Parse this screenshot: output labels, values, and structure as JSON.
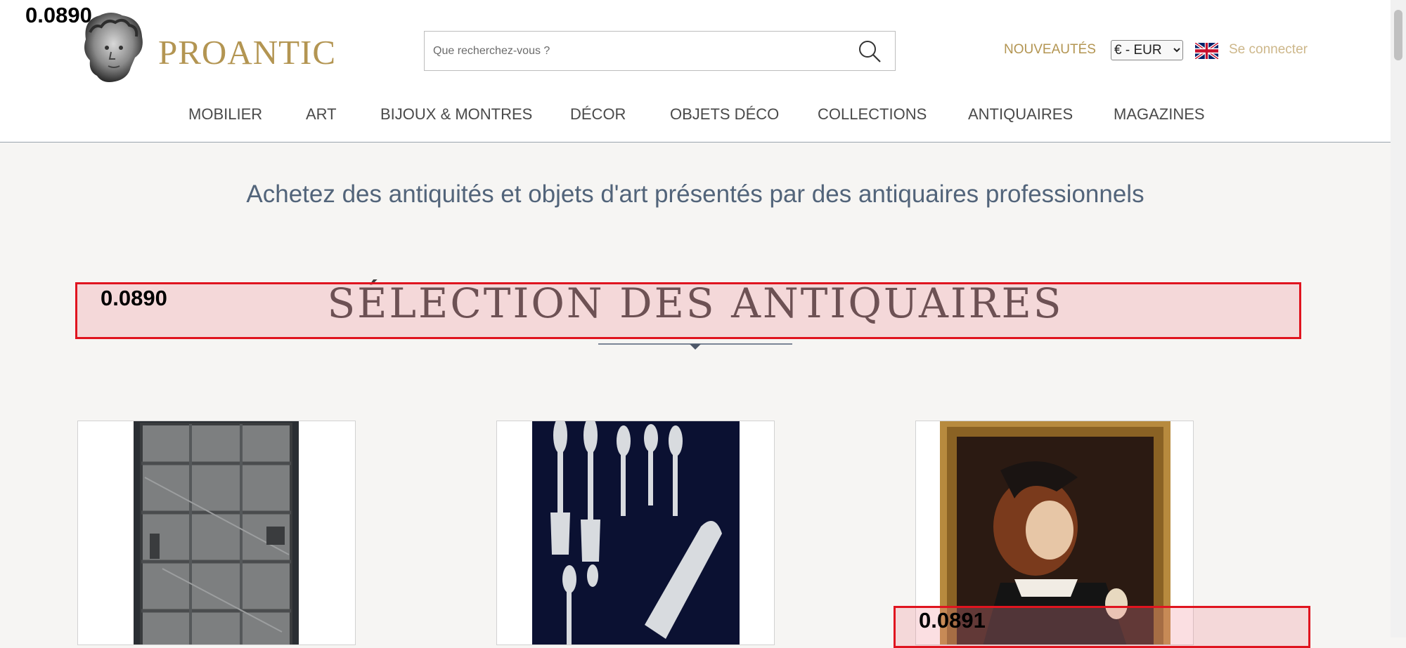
{
  "logo": {
    "text": "PROANTIC",
    "icon": "marble-bust-icon"
  },
  "search": {
    "placeholder": "Que recherchez-vous ?",
    "icon": "search-icon"
  },
  "header": {
    "nouveautes": "NOUVEAUTÉS",
    "currency": "€ - EUR",
    "language_icon": "uk-flag-icon",
    "login": "Se connecter"
  },
  "nav": {
    "items": [
      {
        "label": "MOBILIER"
      },
      {
        "label": "ART"
      },
      {
        "label": "BIJOUX & MONTRES"
      },
      {
        "label": "DÉCOR"
      },
      {
        "label": "OBJETS DÉCO"
      },
      {
        "label": "COLLECTIONS"
      },
      {
        "label": "ANTIQUAIRES"
      },
      {
        "label": "MAGAZINES"
      }
    ]
  },
  "tagline": "Achetez des antiquités et objets d'art présentés par des antiquaires professionnels",
  "section": {
    "title": "SÉLECTION DES ANTIQUAIRES"
  },
  "products": [
    {
      "image": "iron-studded-door"
    },
    {
      "image": "silver-cutlery-set"
    },
    {
      "image": "framed-portrait-painting"
    }
  ],
  "overlays": [
    {
      "score": "0.0890"
    },
    {
      "score": "0.0890"
    },
    {
      "score": "0.0891"
    }
  ],
  "colors": {
    "brand_gold": "#b39552",
    "overlay_red": "#e0141f",
    "tagline": "#52647a"
  }
}
